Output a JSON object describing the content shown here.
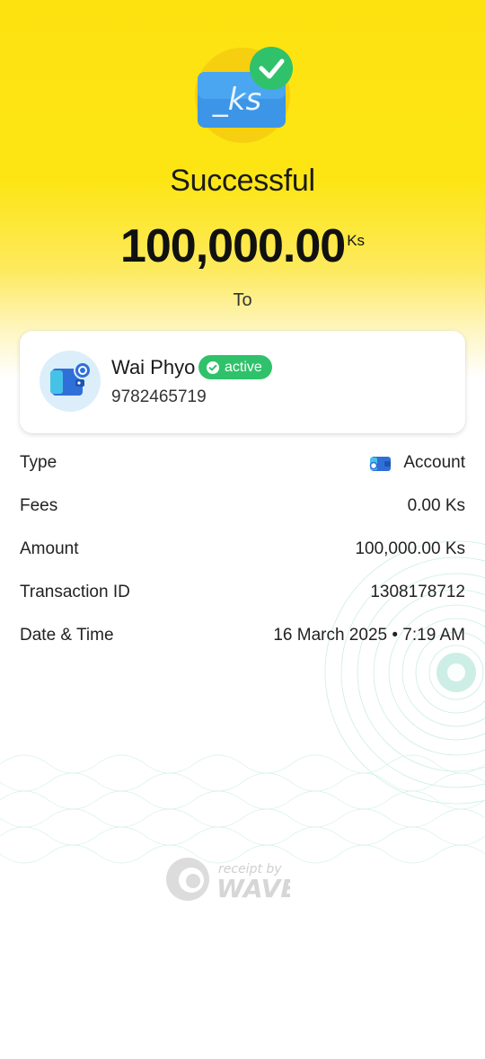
{
  "status": {
    "icon": "currency-card-check-icon",
    "icon_text": "_ks",
    "title": "Successful"
  },
  "amount": {
    "value": "100,000.00",
    "unit": "Ks"
  },
  "to_label": "To",
  "recipient": {
    "avatar_icon": "wallet-icon",
    "name": "Wai Phyo",
    "badge": "active",
    "phone": "9782465719"
  },
  "details": {
    "type": {
      "label": "Type",
      "value": "Account",
      "icon": "wallet-icon"
    },
    "fees": {
      "label": "Fees",
      "value": "0.00 Ks"
    },
    "amount": {
      "label": "Amount",
      "value": "100,000.00 Ks"
    },
    "transaction_id": {
      "label": "Transaction ID",
      "value": "1308178712"
    },
    "date_time": {
      "label": "Date & Time",
      "value": "16 March 2025 • 7:19 AM"
    }
  },
  "footer": {
    "logo_icon": "wave-logo-icon",
    "logo_small": "receipt by",
    "logo_big": "WAVE"
  },
  "colors": {
    "brand_yellow": "#fde210",
    "success_green": "#2fc26b",
    "wallet_blue": "#2f6fd8"
  }
}
